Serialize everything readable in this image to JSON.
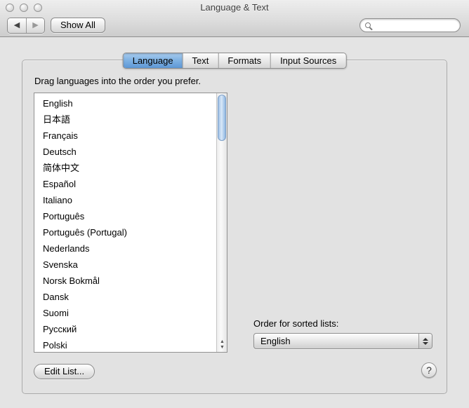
{
  "titlebar": {
    "title": "Language & Text"
  },
  "toolbar": {
    "back_icon": "◀",
    "forward_icon": "▶",
    "show_all_label": "Show All",
    "search_value": ""
  },
  "tabs": [
    {
      "label": "Language",
      "selected": true
    },
    {
      "label": "Text",
      "selected": false
    },
    {
      "label": "Formats",
      "selected": false
    },
    {
      "label": "Input Sources",
      "selected": false
    }
  ],
  "content": {
    "instruction": "Drag languages into the order you prefer.",
    "languages": [
      "English",
      "日本語",
      "Français",
      "Deutsch",
      "简体中文",
      "Español",
      "Italiano",
      "Português",
      "Português (Portugal)",
      "Nederlands",
      "Svenska",
      "Norsk Bokmål",
      "Dansk",
      "Suomi",
      "Русский",
      "Polski"
    ],
    "sorted_lists_label": "Order for sorted lists:",
    "sorted_lists_value": "English",
    "edit_list_label": "Edit List...",
    "help_label": "?"
  },
  "colors": {
    "selected_tab_top": "#a7cbee",
    "selected_tab_bottom": "#5e98d6",
    "scroll_thumb": "#8fb7e2"
  }
}
